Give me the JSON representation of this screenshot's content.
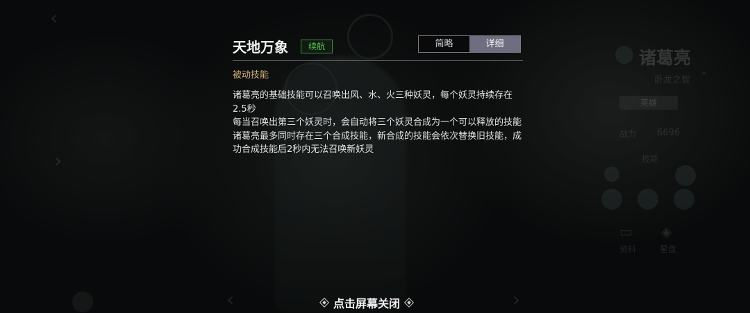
{
  "panel": {
    "title": "天地万象",
    "tag": "续航",
    "tabs": [
      {
        "label": "简略",
        "active": false
      },
      {
        "label": "详细",
        "active": true
      }
    ],
    "section_label": "被动技能",
    "description": [
      "诸葛亮的基础技能可以召唤出风、水、火三种妖灵，每个妖灵持续存在2.5秒",
      "每当召唤出第三个妖灵时，会自动将三个妖灵合成为一个可以释放的技能",
      "诸葛亮最多同时存在三个合成技能，新合成的技能会依次替换旧技能，成功合成技能后2秒内无法召唤新妖灵"
    ]
  },
  "footer": {
    "close_hint": "点击屏幕关闭"
  },
  "background": {
    "hero_name": "诸葛亮",
    "hero_title": "卧龙之智",
    "role_button": "英雄",
    "power_label": "战力",
    "power_value": "6696",
    "skills_label": "技能",
    "info_label": "资料",
    "star_label": "星盘"
  },
  "colors": {
    "tag_green": "#56c456",
    "section_gold": "#d2b37a",
    "active_tab": "#6f6d80"
  }
}
